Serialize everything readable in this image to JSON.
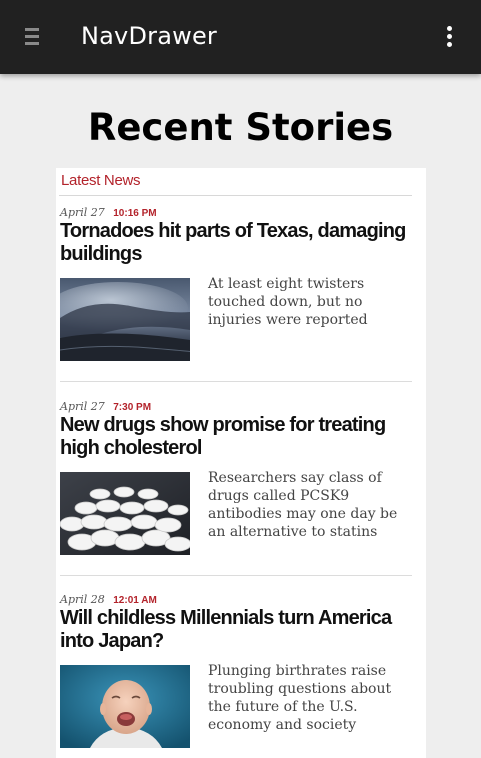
{
  "app_bar": {
    "title": "NavDrawer",
    "menu_icon": "hamburger-menu-icon",
    "overflow_icon": "more-vert-icon",
    "background": "#212121"
  },
  "page": {
    "title": "Recent Stories",
    "background": "#eeeeee"
  },
  "news": {
    "section_label": "Latest News",
    "accent_color": "#b3232b",
    "stories": [
      {
        "date": "April 27",
        "time": "10:16 PM",
        "headline": "Tornadoes hit parts of Texas, damaging buildings",
        "summary": "At least eight twisters touched down, but no injuries were reported",
        "image": "tornado-storm-cloud-photo"
      },
      {
        "date": "April 27",
        "time": "7:30 PM",
        "headline": "New drugs show promise for treating high cholesterol",
        "summary": "Researchers say class of drugs called PCSK9 antibodies may one day be an alternative to statins",
        "image": "white-pills-photo"
      },
      {
        "date": "April 28",
        "time": "12:01 AM",
        "headline": "Will childless Millennials turn America into Japan?",
        "summary": "Plunging birthrates raise troubling questions about the future of the U.S. economy and society",
        "image": "crying-baby-photo"
      }
    ]
  }
}
